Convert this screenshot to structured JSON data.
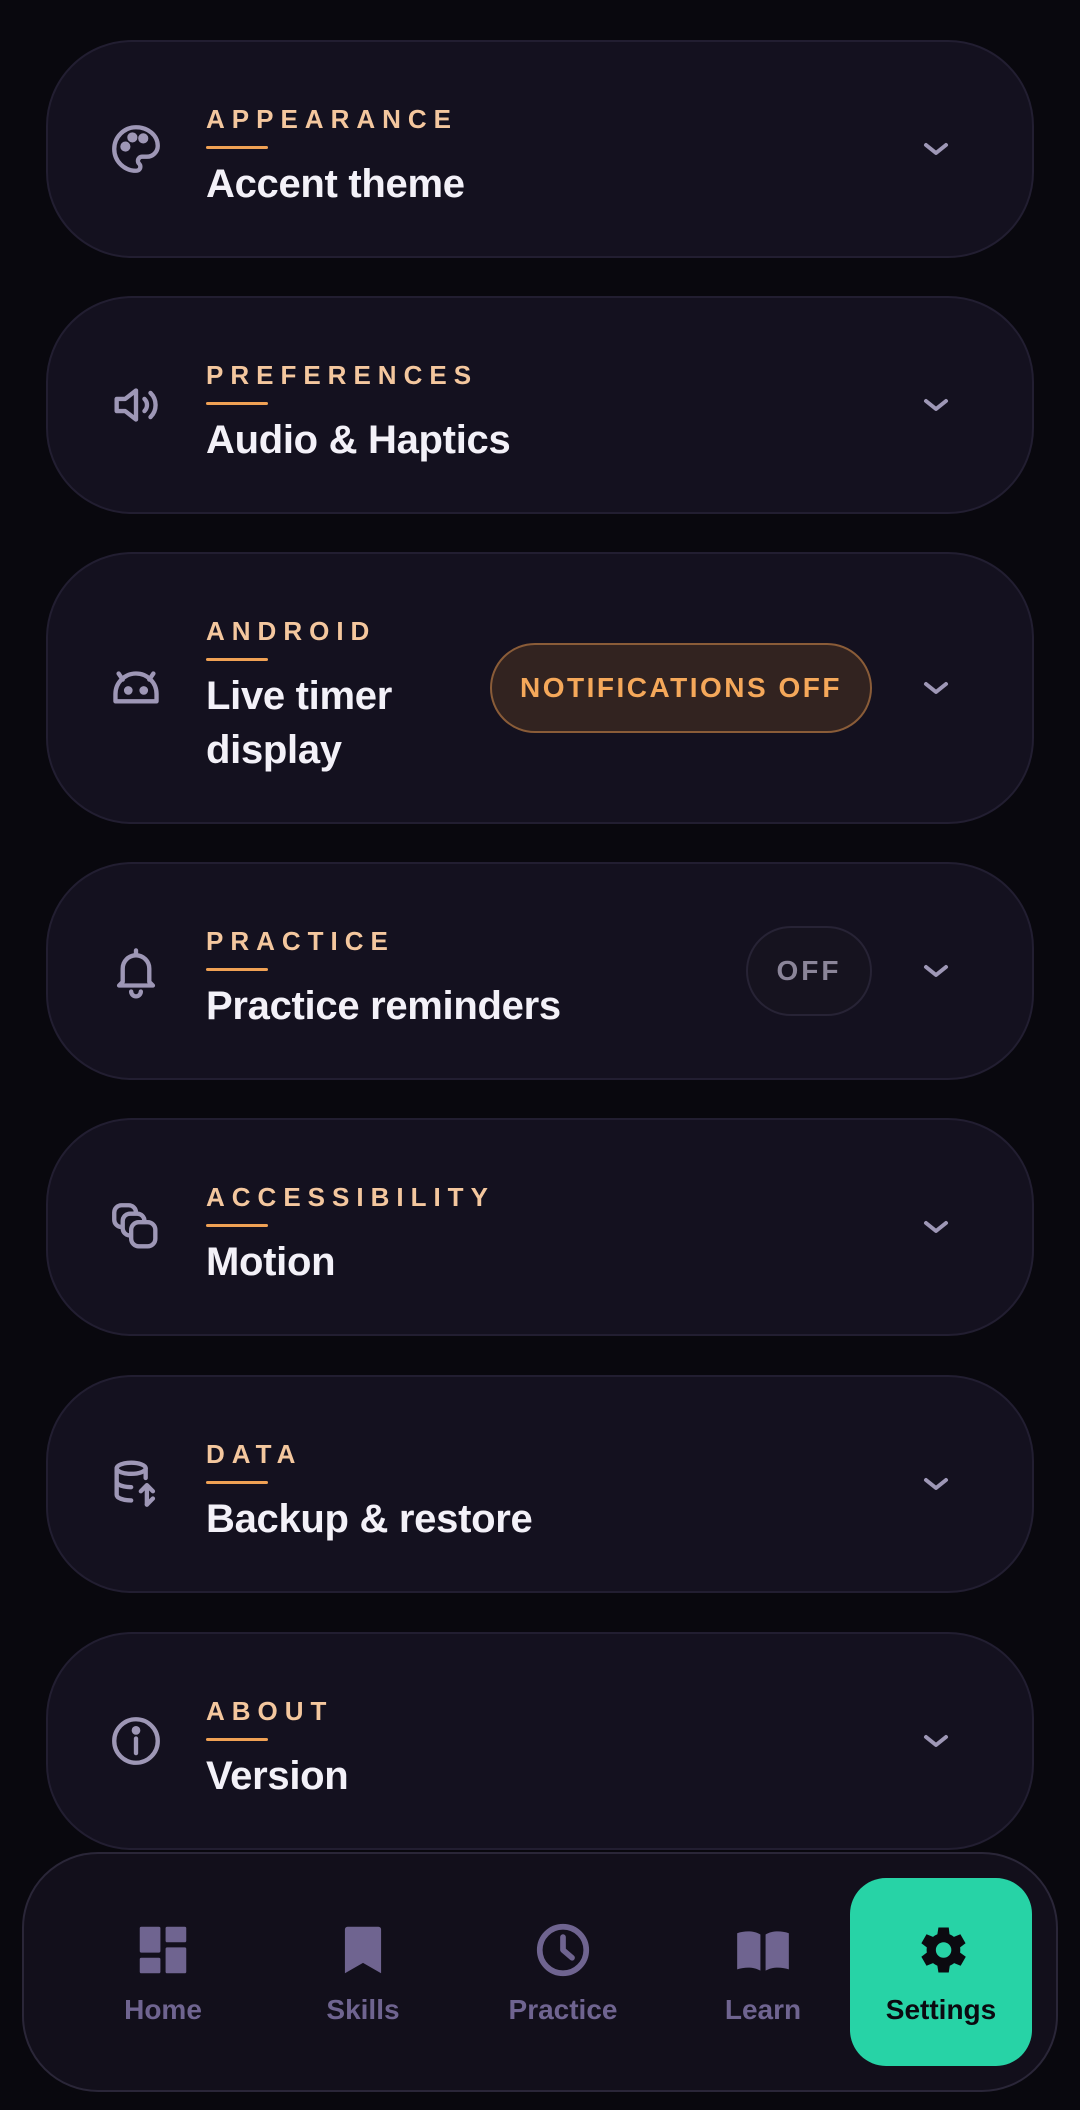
{
  "colors": {
    "background": "#09080e",
    "card": "#14111f",
    "eyebrow": "#f4c79e",
    "accent_rule": "#f0a154",
    "warning": "#f5a85a",
    "active_nav": "#27d3a6",
    "nav_inactive": "#6f6490"
  },
  "settings": [
    {
      "section": "APPEARANCE",
      "title": "Accent theme",
      "icon": "palette-icon",
      "expand_icon": "chevron-down-icon"
    },
    {
      "section": "PREFERENCES",
      "title": "Audio & Haptics",
      "icon": "speaker-icon",
      "expand_icon": "chevron-down-icon"
    },
    {
      "section": "ANDROID",
      "title": "Live timer display",
      "icon": "android-icon",
      "badge": "NOTIFICATIONS OFF",
      "expand_icon": "chevron-down-icon"
    },
    {
      "section": "PRACTICE",
      "title": "Practice reminders",
      "icon": "bell-icon",
      "badge": "OFF",
      "expand_icon": "chevron-down-icon"
    },
    {
      "section": "ACCESSIBILITY",
      "title": "Motion",
      "icon": "motion-icon",
      "expand_icon": "chevron-down-icon"
    },
    {
      "section": "DATA",
      "title": "Backup & restore",
      "icon": "database-transfer-icon",
      "expand_icon": "chevron-down-icon"
    },
    {
      "section": "ABOUT",
      "title": "Version",
      "icon": "info-icon",
      "expand_icon": "chevron-down-icon"
    }
  ],
  "nav": {
    "items": [
      {
        "label": "Home",
        "icon": "dashboard-icon",
        "active": false
      },
      {
        "label": "Skills",
        "icon": "bookmark-icon",
        "active": false
      },
      {
        "label": "Practice",
        "icon": "clock-icon",
        "active": false
      },
      {
        "label": "Learn",
        "icon": "book-icon",
        "active": false
      },
      {
        "label": "Settings",
        "icon": "gear-icon",
        "active": true
      }
    ]
  }
}
